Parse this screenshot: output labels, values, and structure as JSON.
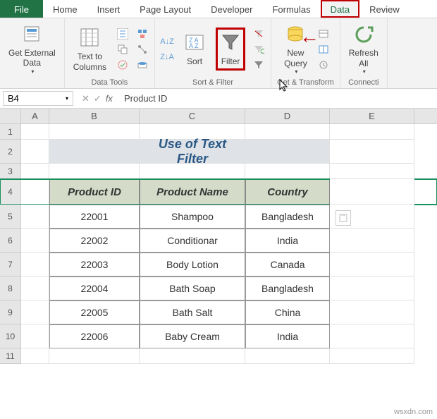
{
  "tabs": {
    "file": "File",
    "home": "Home",
    "insert": "Insert",
    "page_layout": "Page Layout",
    "developer": "Developer",
    "formulas": "Formulas",
    "data": "Data",
    "review": "Review"
  },
  "ribbon": {
    "get_external": "Get External\nData",
    "text_to_columns": "Text to\nColumns",
    "data_tools": "Data Tools",
    "sort": "Sort",
    "filter": "Filter",
    "sort_filter": "Sort & Filter",
    "new_query": "New\nQuery",
    "get_transform": "Get & Transform",
    "refresh_all": "Refresh\nAll",
    "connections": "Connecti"
  },
  "name_box": "B4",
  "formula_value": "Product ID",
  "columns": {
    "A": "A",
    "B": "B",
    "C": "C",
    "D": "D",
    "E": "E"
  },
  "rows": [
    "1",
    "2",
    "3",
    "4",
    "5",
    "6",
    "7",
    "8",
    "9",
    "10",
    "11"
  ],
  "title": "Use of Text Filter",
  "headers": {
    "b": "Product ID",
    "c": "Product Name",
    "d": "Country"
  },
  "data": [
    {
      "id": "22001",
      "name": "Shampoo",
      "country": "Bangladesh"
    },
    {
      "id": "22002",
      "name": "Conditionar",
      "country": "India"
    },
    {
      "id": "22003",
      "name": "Body Lotion",
      "country": "Canada"
    },
    {
      "id": "22004",
      "name": "Bath Soap",
      "country": "Bangladesh"
    },
    {
      "id": "22005",
      "name": "Bath Salt",
      "country": "China"
    },
    {
      "id": "22006",
      "name": "Baby Cream",
      "country": "India"
    }
  ],
  "watermark": "wsxdn.com"
}
